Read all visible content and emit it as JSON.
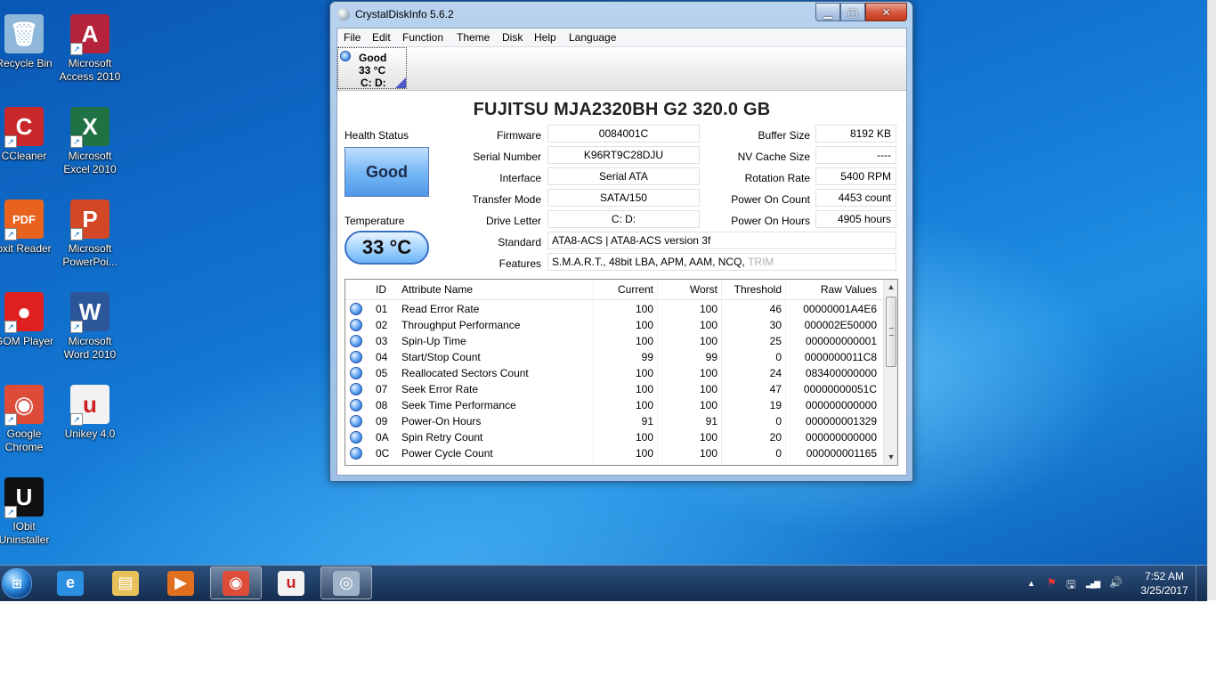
{
  "desktop": {
    "icons": [
      {
        "label": "Recycle Bin",
        "glyph": "🗑",
        "color": "#8fb7d9"
      },
      {
        "label": "Microsoft Access 2010",
        "glyph": "A",
        "color": "#b4233a"
      },
      {
        "label": "CCleaner",
        "glyph": "C",
        "color": "#c8282a"
      },
      {
        "label": "Microsoft Excel 2010",
        "glyph": "X",
        "color": "#207245"
      },
      {
        "label": "oxit Reader",
        "glyph": "PDF",
        "color": "#e8641e"
      },
      {
        "label": "Microsoft PowerPoi...",
        "glyph": "P",
        "color": "#d24726"
      },
      {
        "label": "GOM Player",
        "glyph": "●",
        "color": "#e02020"
      },
      {
        "label": "Microsoft Word 2010",
        "glyph": "W",
        "color": "#2b579a"
      },
      {
        "label": "Google Chrome",
        "glyph": "◉",
        "color": "#dd4b39"
      },
      {
        "label": "Unikey 4.0",
        "glyph": "u",
        "color": "#f2f2f2"
      },
      {
        "label": "IObit Uninstaller",
        "glyph": "U",
        "color": "#111111"
      }
    ]
  },
  "window": {
    "title": "CrystalDiskInfo 5.6.2",
    "min_glyph": "▁",
    "max_glyph": "▢",
    "close_glyph": "✕",
    "menu": [
      "File",
      "Edit",
      "Function",
      "Theme",
      "Disk",
      "Help",
      "Language"
    ],
    "disk_tab": {
      "status": "Good",
      "temperature": "33 °C",
      "letters": "C: D:"
    },
    "disk_model": "FUJITSU MJA2320BH G2  320.0 GB",
    "health": {
      "label": "Health Status",
      "value": "Good"
    },
    "temperature": {
      "label": "Temperature",
      "value": "33 °C"
    },
    "info_labels": {
      "firmware": "Firmware",
      "serial": "Serial Number",
      "interface": "Interface",
      "transfer": "Transfer Mode",
      "drive_letter": "Drive Letter",
      "standard": "Standard",
      "features": "Features",
      "buffer": "Buffer Size",
      "nv_cache": "NV Cache Size",
      "rotation": "Rotation Rate",
      "power_on_count": "Power On Count",
      "power_on_hours": "Power On Hours"
    },
    "info_values": {
      "firmware": "0084001C",
      "serial": "K96RT9C28DJU",
      "interface": "Serial ATA",
      "transfer": "SATA/150",
      "drive_letter": "C: D:",
      "standard": "ATA8-ACS | ATA8-ACS version 3f",
      "features": "S.M.A.R.T., 48bit LBA, APM, AAM, NCQ,",
      "features_disabled": "TRIM",
      "buffer": "8192 KB",
      "nv_cache": "----",
      "rotation": "5400 RPM",
      "power_on_count": "4453 count",
      "power_on_hours": "4905 hours"
    },
    "smart": {
      "columns": [
        "ID",
        "Attribute Name",
        "Current",
        "Worst",
        "Threshold",
        "Raw Values"
      ],
      "rows": [
        {
          "id": "01",
          "name": "Read Error Rate",
          "current": "100",
          "worst": "100",
          "threshold": "46",
          "raw": "00000001A4E6"
        },
        {
          "id": "02",
          "name": "Throughput Performance",
          "current": "100",
          "worst": "100",
          "threshold": "30",
          "raw": "000002E50000"
        },
        {
          "id": "03",
          "name": "Spin-Up Time",
          "current": "100",
          "worst": "100",
          "threshold": "25",
          "raw": "000000000001"
        },
        {
          "id": "04",
          "name": "Start/Stop Count",
          "current": "99",
          "worst": "99",
          "threshold": "0",
          "raw": "0000000011C8"
        },
        {
          "id": "05",
          "name": "Reallocated Sectors Count",
          "current": "100",
          "worst": "100",
          "threshold": "24",
          "raw": "083400000000"
        },
        {
          "id": "07",
          "name": "Seek Error Rate",
          "current": "100",
          "worst": "100",
          "threshold": "47",
          "raw": "00000000051C"
        },
        {
          "id": "08",
          "name": "Seek Time Performance",
          "current": "100",
          "worst": "100",
          "threshold": "19",
          "raw": "000000000000"
        },
        {
          "id": "09",
          "name": "Power-On Hours",
          "current": "91",
          "worst": "91",
          "threshold": "0",
          "raw": "000000001329"
        },
        {
          "id": "0A",
          "name": "Spin Retry Count",
          "current": "100",
          "worst": "100",
          "threshold": "20",
          "raw": "000000000000"
        },
        {
          "id": "0C",
          "name": "Power Cycle Count",
          "current": "100",
          "worst": "100",
          "threshold": "0",
          "raw": "000000001165"
        }
      ]
    }
  },
  "taskbar": {
    "start_glyph": "⊞",
    "buttons": [
      {
        "name": "internet-explorer",
        "glyph": "e",
        "color": "#2a8fe0",
        "active": false
      },
      {
        "name": "file-explorer",
        "glyph": "▤",
        "color": "#e8c15a",
        "active": false
      },
      {
        "name": "media-player",
        "glyph": "▶",
        "color": "#e07020",
        "active": false
      },
      {
        "name": "google-chrome",
        "glyph": "◉",
        "color": "#dd4b39",
        "active": true
      },
      {
        "name": "unikey",
        "glyph": "u",
        "color": "#f2f2f2",
        "active": false
      },
      {
        "name": "crystaldiskinfo",
        "glyph": "◎",
        "color": "#9fb3c8",
        "active": true
      }
    ],
    "tray": {
      "show_hidden_glyph": "▲",
      "flag_glyph": "⚑",
      "device_glyph": "🖫",
      "network_glyph": "▂▄▆",
      "volume_glyph": "🔊"
    },
    "clock": {
      "time": "7:52 AM",
      "date": "3/25/2017"
    }
  },
  "colors": {
    "status_good": "#4f98e8",
    "desktop": "#1377d3",
    "close_button": "#c2391a"
  }
}
